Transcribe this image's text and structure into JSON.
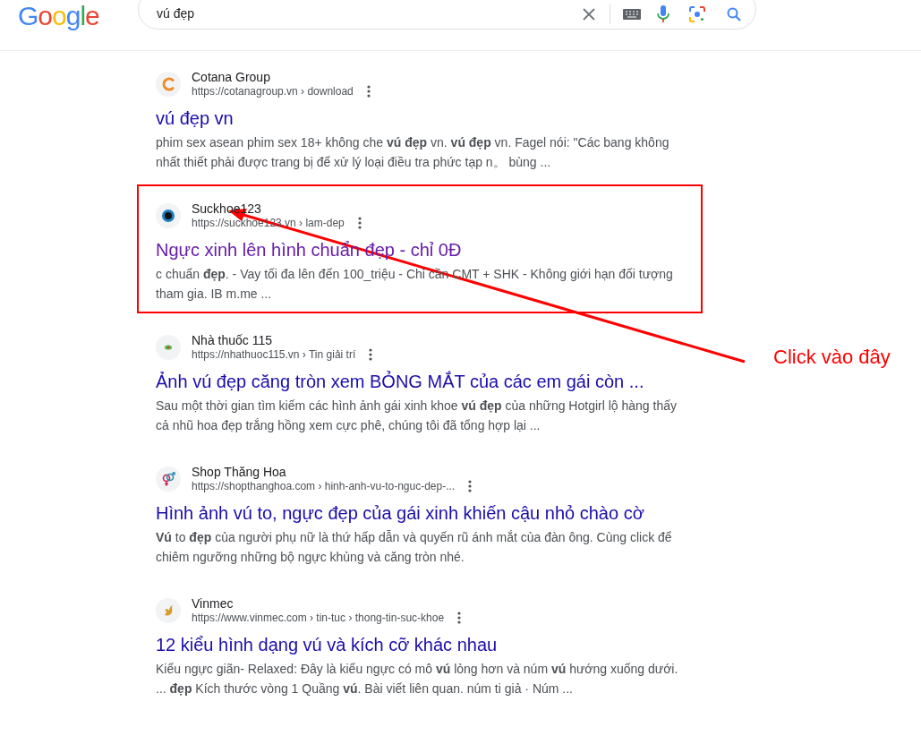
{
  "logo": "Google",
  "search": {
    "query": "vú đẹp"
  },
  "results": [
    {
      "kind": "c-logo",
      "site": "Cotana Group",
      "url": "https://cotanagroup.vn › download",
      "title": "vú đẹp vn",
      "visited": false,
      "highlighted": false,
      "snippet": "phim sex asean phim sex 18+ không che **vú đẹp** vn. **vú đẹp** vn. Fagel nói: \"Các bang không nhất thiết phải được trang bị để xử lý loại điều tra phức tạp n。 bùng ..."
    },
    {
      "kind": "eye",
      "site": "Suckhoe123",
      "url": "https://suckhoe123.vn › lam-dep",
      "title": "Ngực xinh lên hình chuẩn đẹp - chỉ 0Đ",
      "visited": true,
      "highlighted": true,
      "snippet": "c chuẩn **đẹp**. - Vay tối đa lên đến 100_triệu - Chỉ cần CMT + SHK - Không giới hạn đối tượng tham gia. IB m.me ..."
    },
    {
      "kind": "heart",
      "site": "Nhà thuốc 115",
      "url": "https://nhathuoc115.vn › Tin giải trí",
      "title": "Ảnh vú đẹp căng tròn xem BỎNG MẮT của các em gái còn ...",
      "visited": false,
      "highlighted": false,
      "snippet": "Sau một thời gian tìm kiếm các hình ảnh gái xinh khoe **vú đẹp** của những Hotgirl lộ hàng thấy cả nhũ hoa đẹp trắng hồng xem cực phê, chúng tôi đã tổng hợp lại ..."
    },
    {
      "kind": "gender",
      "site": "Shop Thăng Hoa",
      "url": "https://shopthanghoa.com › hinh-anh-vu-to-nguc-dep-...",
      "title": "Hình ảnh vú to, ngực đẹp của gái xinh khiến cậu nhỏ chào cờ",
      "visited": false,
      "highlighted": false,
      "snippet": "**Vú** to **đẹp** của người phụ nữ là thứ hấp dẫn và quyến rũ ánh mắt của đàn ông. Cùng click để chiêm ngưỡng những bộ ngực khủng và căng tròn nhé."
    },
    {
      "kind": "flame",
      "site": "Vinmec",
      "url": "https://www.vinmec.com › tin-tuc › thong-tin-suc-khoe",
      "title": "12 kiểu hình dạng vú và kích cỡ khác nhau",
      "visited": false,
      "highlighted": false,
      "snippet": "Kiểu ngực giãn- Relaxed: Đây là kiểu ngực có mô **vú** lỏng hơn và núm **vú** hướng xuống dưới. ... **đẹp** Kích thước vòng 1 Quầng **vú**. Bài viết liên quan. núm ti giả · Núm ..."
    }
  ],
  "annotation": {
    "label": "Click vào đây"
  }
}
